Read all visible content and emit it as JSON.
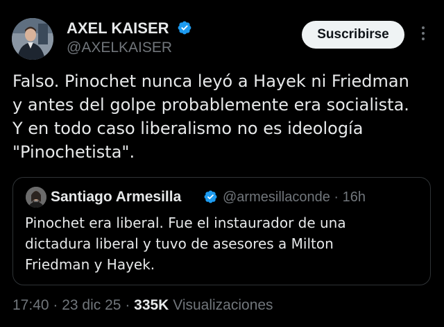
{
  "tweet": {
    "author": {
      "name": "AXEL KAISER",
      "handle": "@AXELKAISER",
      "verified": true,
      "avatar_icon": "profile-photo"
    },
    "subscribe_label": "Suscribirse",
    "more_icon": "more-vertical-icon",
    "text_lines": [
      "Falso. Pinochet nunca leyó a Hayek ni Friedman",
      "y antes del golpe probablemente era socialista.",
      "Y en todo caso liberalismo no es ideología",
      "\"Pinochetista\"."
    ],
    "quoted": {
      "name": "Santiago Armesilla",
      "handle_time": "@armesillaconde · 16h",
      "verified": true,
      "avatar_icon": "profile-photo",
      "text_lines": [
        "Pinochet era liberal. Fue el instaurador de una",
        "dictadura liberal y tuvo de asesores a Milton",
        "Friedman y Hayek."
      ]
    },
    "meta": {
      "time": "17:40",
      "date": "23 dic 25",
      "views_count": "335K",
      "views_label": "Visualizaciones"
    }
  },
  "colors": {
    "background": "#000000",
    "text": "#e7e9ea",
    "secondary": "#71767b",
    "verified": "#1d9bf0",
    "border": "#2f3336",
    "button_bg": "#eff3f4"
  }
}
